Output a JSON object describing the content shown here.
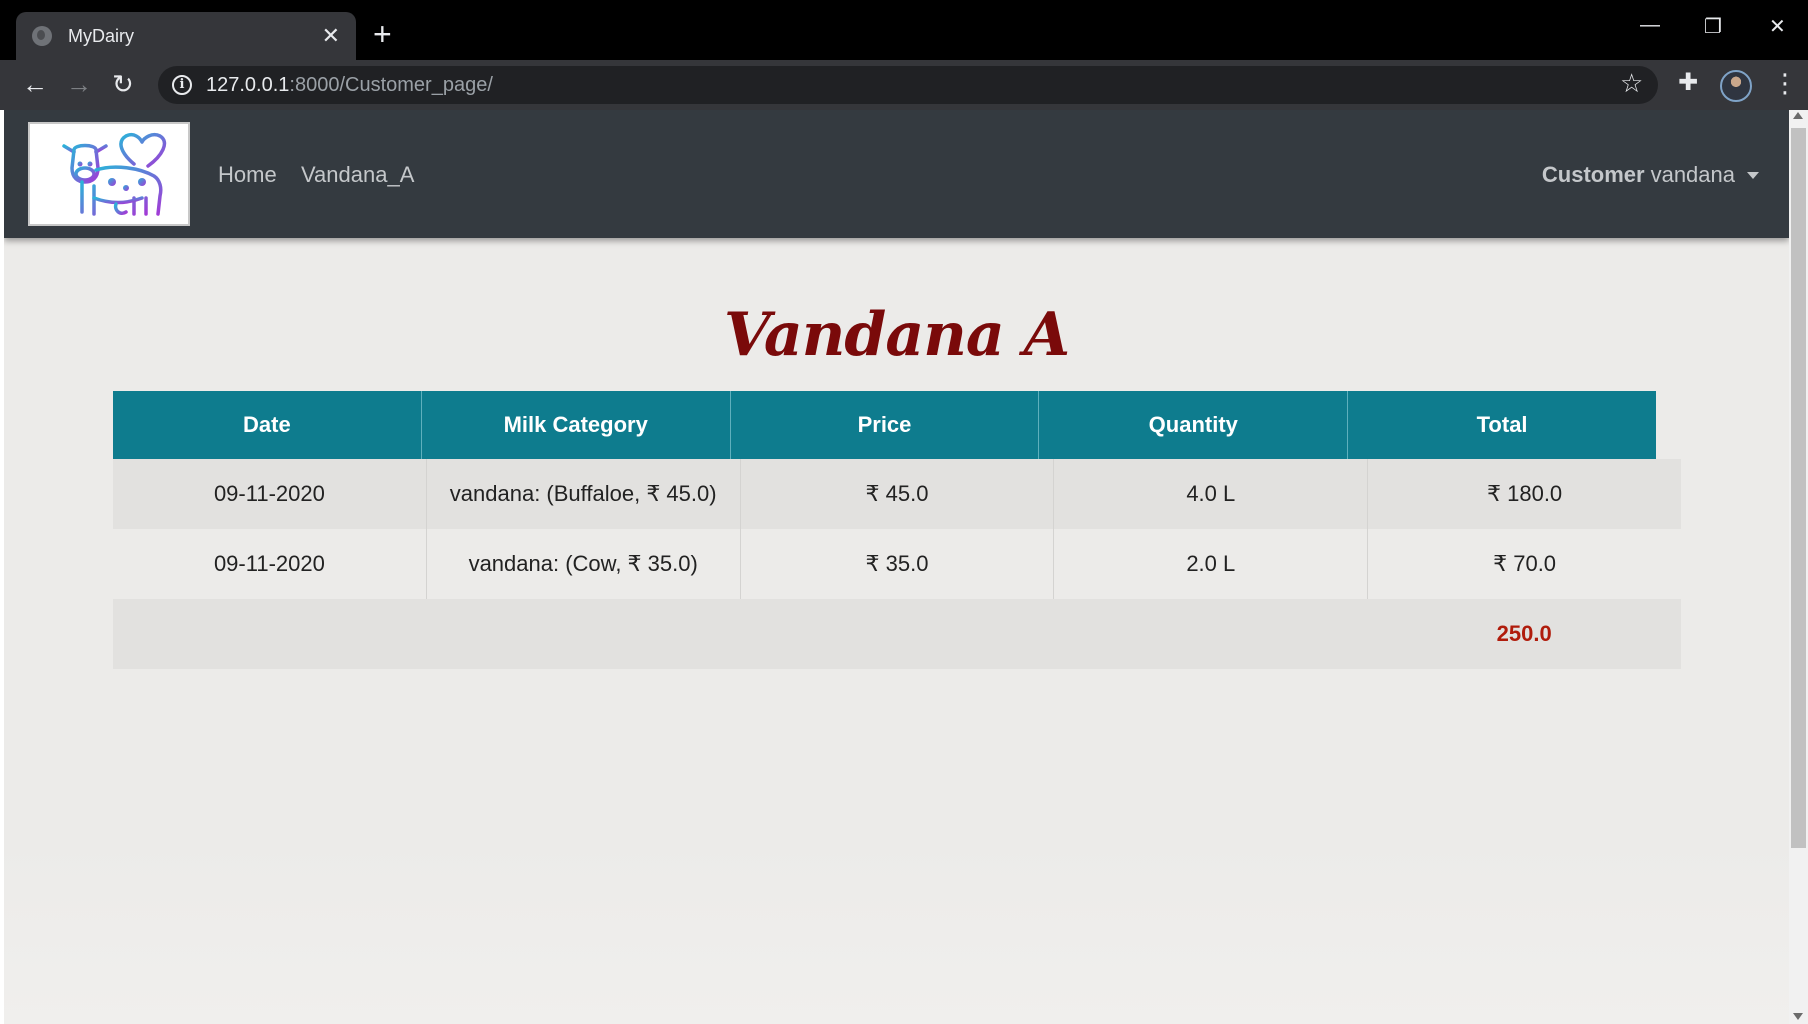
{
  "browser": {
    "tab_title": "MyDairy",
    "tab_close": "✕",
    "new_tab": "+",
    "url_host": "127.0.0.1",
    "url_path": ":8000/Customer_page/",
    "minimize": "—",
    "restore": "❐",
    "close": "✕",
    "back": "←",
    "forward": "→",
    "reload": "↻",
    "info": "i",
    "star": "☆",
    "extensions": "✚",
    "menu": "⋮"
  },
  "navbar": {
    "links": [
      {
        "label": "Home"
      },
      {
        "label": "Vandana_A"
      }
    ],
    "user_role": "Customer",
    "user_name": "vandana"
  },
  "page": {
    "title": "Vandana A"
  },
  "table": {
    "headers": [
      "Date",
      "Milk Category",
      "Price",
      "Quantity",
      "Total"
    ],
    "rows": [
      [
        "09-11-2020",
        "vandana: (Buffaloe, ₹ 45.0)",
        "₹ 45.0",
        "4.0 L",
        "₹ 180.0"
      ],
      [
        "09-11-2020",
        "vandana: (Cow, ₹ 35.0)",
        "₹ 35.0",
        "2.0 L",
        "₹ 70.0"
      ]
    ],
    "grand_total": "250.0"
  },
  "colors": {
    "header_bg": "#0e7c8e",
    "navbar_bg": "#343a40",
    "title_color": "#7a0a0a",
    "total_color": "#b01c0c"
  }
}
